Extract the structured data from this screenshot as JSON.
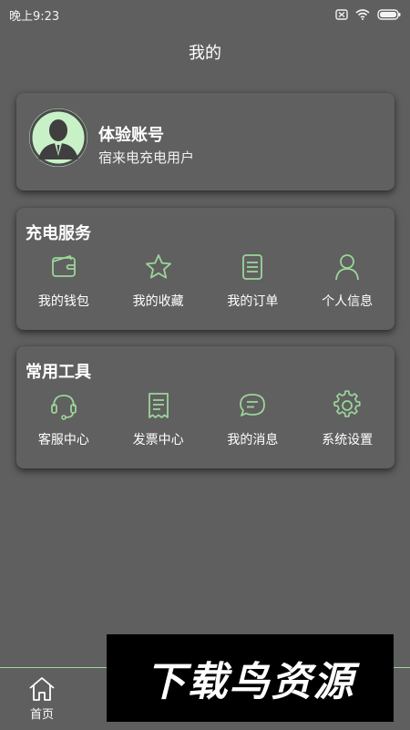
{
  "status_bar": {
    "time": "晚上9:23",
    "icons": [
      "sim-off-icon",
      "wifi-icon",
      "battery-icon"
    ]
  },
  "page": {
    "title": "我的"
  },
  "profile": {
    "name": "体验账号",
    "subtitle": "宿来电充电用户",
    "avatar_icon": "user-avatar-icon"
  },
  "charging_services": {
    "title": "充电服务",
    "items": [
      {
        "label": "我的钱包",
        "icon": "wallet-icon"
      },
      {
        "label": "我的收藏",
        "icon": "star-icon"
      },
      {
        "label": "我的订单",
        "icon": "order-icon"
      },
      {
        "label": "个人信息",
        "icon": "person-icon"
      }
    ]
  },
  "common_tools": {
    "title": "常用工具",
    "items": [
      {
        "label": "客服中心",
        "icon": "headset-icon"
      },
      {
        "label": "发票中心",
        "icon": "receipt-icon"
      },
      {
        "label": "我的消息",
        "icon": "message-icon"
      },
      {
        "label": "系统设置",
        "icon": "settings-icon"
      }
    ]
  },
  "bottom_nav": {
    "items": [
      {
        "label": "首页",
        "icon": "home-icon"
      }
    ]
  },
  "watermark": {
    "text": "下载鸟资源"
  },
  "colors": {
    "background": "#5f5f5f",
    "card": "#606060",
    "accent": "#9cd49a",
    "avatar_bg": "#c9f1c7"
  }
}
